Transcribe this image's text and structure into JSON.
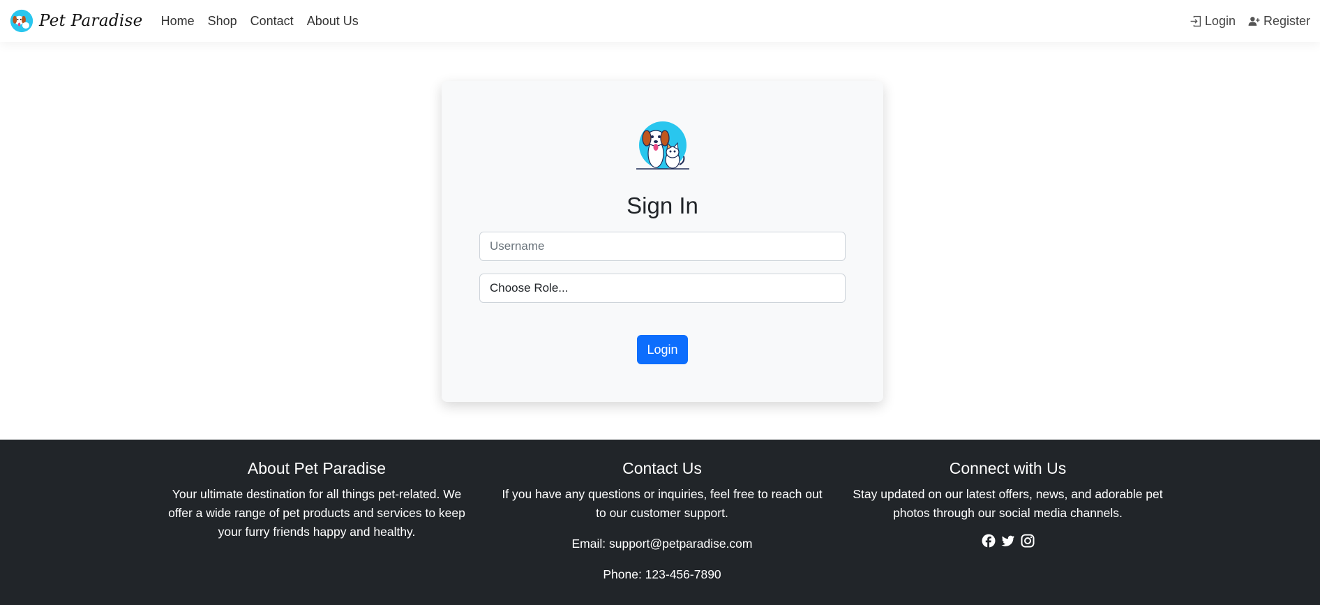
{
  "brand": {
    "name": "Pet Paradise",
    "logo_icon": "dog-cat-logo-icon"
  },
  "nav": {
    "links": [
      "Home",
      "Shop",
      "Contact",
      "About Us"
    ]
  },
  "auth": {
    "login": "Login",
    "register": "Register"
  },
  "signin": {
    "title": "Sign In",
    "username_placeholder": "Username",
    "role_selected": "Choose Role...",
    "submit": "Login"
  },
  "footer": {
    "about": {
      "title": "About Pet Paradise",
      "text": "Your ultimate destination for all things pet-related. We offer a wide range of pet products and services to keep your furry friends happy and healthy."
    },
    "contact": {
      "title": "Contact Us",
      "text": "If you have any questions or inquiries, feel free to reach out to our customer support.",
      "email": "Email: support@petparadise.com",
      "phone": "Phone: 123-456-7890"
    },
    "connect": {
      "title": "Connect with Us",
      "text": "Stay updated on our latest offers, news, and adorable pet photos through our social media channels.",
      "social_icons": [
        "facebook-icon",
        "twitter-icon",
        "instagram-icon"
      ]
    }
  },
  "colors": {
    "primary": "#0d6efd",
    "footer_bg": "#212529",
    "card_bg": "#f8f9fa",
    "logo_circle": "#29c6ee"
  }
}
